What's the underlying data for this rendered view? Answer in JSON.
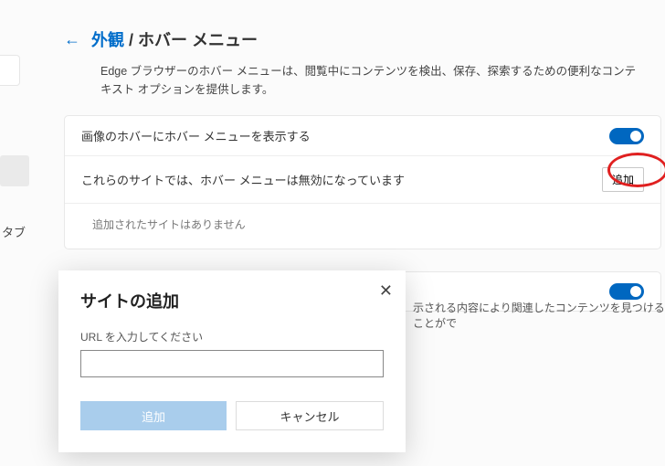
{
  "sidebar": {
    "tab_fragment": "タブ"
  },
  "header": {
    "appearance": "外観",
    "separator": " / ",
    "pagename": "ホバー メニュー"
  },
  "description": "Edge ブラウザーのホバー メニューは、閲覧中にコンテンツを検出、保存、探索するための便利なコンテキスト オプションを提供します。",
  "rows": {
    "show_on_images": "画像のホバーにホバー メニューを表示する",
    "disabled_sites": "これらのサイトでは、ホバー メニューは無効になっています",
    "no_sites": "追加されたサイトはありません"
  },
  "buttons": {
    "add": "追加"
  },
  "partial_row": {
    "right": "示される内容により関連したコンテンツを見つけることがで"
  },
  "dialog": {
    "title": "サイトの追加",
    "url_label": "URL を入力してください",
    "add": "追加",
    "cancel": "キャンセル"
  }
}
